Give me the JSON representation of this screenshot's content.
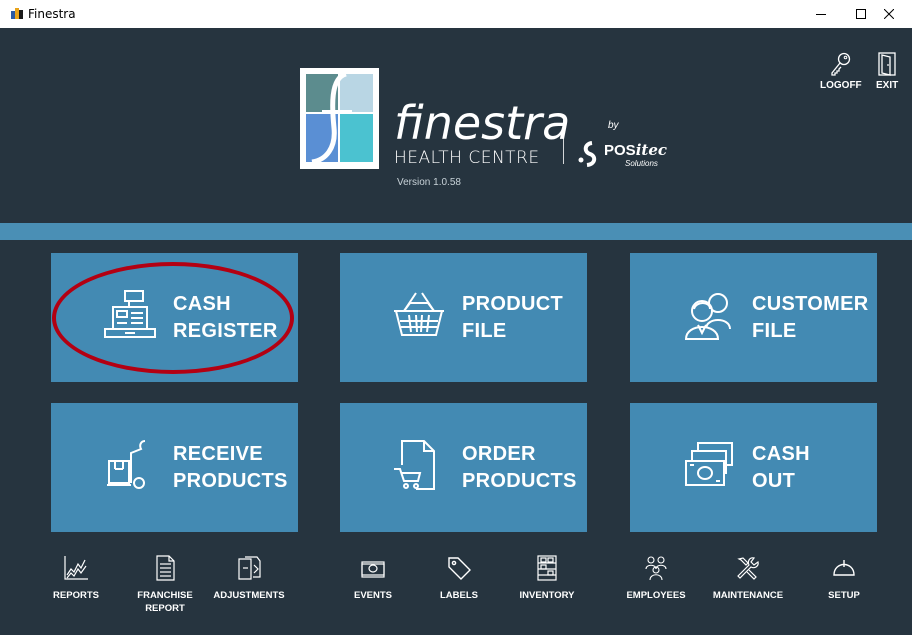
{
  "window": {
    "title": "Finestra"
  },
  "header": {
    "logo_name": "finestra",
    "logo_subtitle": "HEALTH CENTRE",
    "version": "Version 1.0.58",
    "by": "by",
    "brand_pos": "POS",
    "brand_itec": "itec",
    "brand_solutions": "Solutions",
    "actions": [
      {
        "label": "LOGOFF",
        "icon": "key-icon"
      },
      {
        "label": "EXIT",
        "icon": "door-icon"
      }
    ]
  },
  "tiles": [
    {
      "line1": "CASH",
      "line2": "REGISTER",
      "icon": "cash-register-icon"
    },
    {
      "line1": "PRODUCT",
      "line2": "FILE",
      "icon": "basket-icon"
    },
    {
      "line1": "CUSTOMER",
      "line2": "FILE",
      "icon": "customers-icon"
    },
    {
      "line1": "RECEIVE",
      "line2": "PRODUCTS",
      "icon": "hand-truck-icon"
    },
    {
      "line1": "ORDER",
      "line2": "PRODUCTS",
      "icon": "order-cart-icon"
    },
    {
      "line1": "CASH",
      "line2": "OUT",
      "icon": "cash-stack-icon"
    }
  ],
  "bottom_nav": [
    {
      "label": "REPORTS",
      "icon": "chart-icon"
    },
    {
      "label": "FRANCHISE\nREPORT",
      "icon": "document-icon"
    },
    {
      "label": "ADJUSTMENTS",
      "icon": "adjust-icon"
    },
    {
      "label": "EVENTS",
      "icon": "money-icon"
    },
    {
      "label": "LABELS",
      "icon": "tag-icon"
    },
    {
      "label": "INVENTORY",
      "icon": "shelf-icon"
    },
    {
      "label": "EMPLOYEES",
      "icon": "people-icon"
    },
    {
      "label": "MAINTENANCE",
      "icon": "tools-icon"
    },
    {
      "label": "SETUP",
      "icon": "power-icon"
    }
  ],
  "colors": {
    "background": "#26343f",
    "tile": "#438ab3",
    "band": "#4a8fb5",
    "highlight_oval": "#b30012"
  }
}
